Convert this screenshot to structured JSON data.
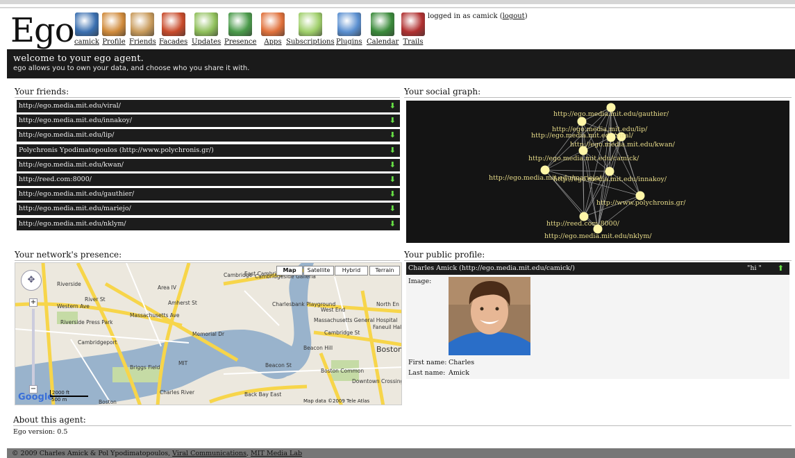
{
  "app": {
    "logo": "Ego"
  },
  "nav": [
    {
      "label": "camick",
      "icon": "user-avatar-icon",
      "color": "#3a6fb0"
    },
    {
      "label": "Profile",
      "icon": "person-icon",
      "color": "#d08a3a"
    },
    {
      "label": "Friends",
      "icon": "people-icon",
      "color": "#c89a5a"
    },
    {
      "label": "Facades",
      "icon": "facades-grid-icon",
      "color": "#c84a2a"
    },
    {
      "label": "Updates",
      "icon": "pencil-notepad-icon",
      "color": "#8fbf5a"
    },
    {
      "label": "Presence",
      "icon": "signal-capsule-icon",
      "color": "#4a9a4a"
    },
    {
      "label": "Apps",
      "icon": "cubes-icon",
      "color": "#e0703a"
    },
    {
      "label": "Subscriptions",
      "icon": "newsletter-icon",
      "color": "#9fcf6a"
    },
    {
      "label": "Plugins",
      "icon": "puzzle-blocks-icon",
      "color": "#5a8fd0"
    },
    {
      "label": "Calendar",
      "icon": "calendar-icon",
      "color": "#3a8a3a"
    },
    {
      "label": "Trails",
      "icon": "map-pin-icon",
      "color": "#b03030"
    }
  ],
  "login": {
    "prefix": "logged in as camick (",
    "logout": "logout",
    "suffix": ")"
  },
  "banner": {
    "title": "welcome to your ego agent.",
    "subtitle": "ego allows you to own your data, and choose who you share it with."
  },
  "sections": {
    "friends": "Your friends:",
    "graph": "Your social graph:",
    "presence": "Your network's presence:",
    "profile": "Your public profile:",
    "about": "About this agent:"
  },
  "friends": [
    "http://ego.media.mit.edu/viral/",
    "http://ego.media.mit.edu/innakoy/",
    "http://ego.media.mit.edu/lip/",
    "Polychronis Ypodimatopoulos (http://www.polychronis.gr/)",
    "http://ego.media.mit.edu/kwan/",
    "http://reed.com:8000/",
    "http://ego.media.mit.edu/gauthier/",
    "http://ego.media.mit.edu/mariejo/",
    "http://ego.media.mit.edu/nklym/"
  ],
  "graph_nodes": [
    "http://ego.media.mit.edu/gauthier/",
    "http://ego.media.mit.edu/lip/",
    "http://ego.media.mit.edu/viral/",
    "http://ego.media.mit.edu/kwan/",
    "http://ego.media.mit.edu/camick/",
    "http://ego.media.mit.edu/mariejo/",
    "http://ego.media.mit.edu/innakoy/",
    "http://www.polychronis.gr/",
    "http://reed.com:8000/",
    "http://ego.media.mit.edu/nklym/"
  ],
  "map": {
    "types": [
      "Map",
      "Satellite",
      "Hybrid",
      "Terrain"
    ],
    "places": [
      "Riverside",
      "Cambridge",
      "Area IV",
      "East Cambridge",
      "Cambridgeside Galleria",
      "Charlesbank Playground",
      "West End",
      "North En",
      "Massachusetts General Hospital",
      "Faneuil Hall Marketplace",
      "Beacon Hill",
      "Boston",
      "Boston Common",
      "Downtown Crossing",
      "Cambridgeport",
      "Briggs Field",
      "MIT",
      "Charles River",
      "Back Bay East",
      "Riverside Press Park",
      "Boston",
      "Amherst St",
      "Memorial Dr",
      "Massachusetts Ave",
      "Cambridge St",
      "Beacon St",
      "Western Ave",
      "River St"
    ],
    "attribution": "Map data ©2009 Tele Atlas",
    "scale_ft": "2000 ft",
    "scale_m": "500 m",
    "google": "Google"
  },
  "profile": {
    "header": "Charles Amick (http://ego.media.mit.edu/camick/)",
    "status": "\"hi \"",
    "image_label": "Image:",
    "first_label": "First name:",
    "first_value": "Charles",
    "last_label": "Last name:",
    "last_value": "Amick"
  },
  "about": {
    "version_label": "Ego version:",
    "version": "0.5"
  },
  "footer": {
    "copyright": "© 2009 Charles Amick & Pol Ypodimatopoulos, ",
    "link1": "Viral Communications",
    "sep": ", ",
    "link2": "MIT Media Lab"
  }
}
